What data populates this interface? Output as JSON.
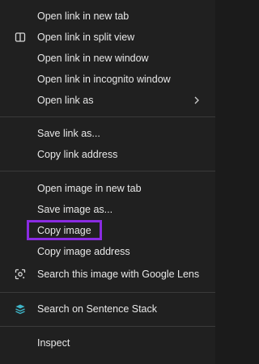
{
  "context_menu": {
    "group_link": {
      "open_new_tab": "Open link in new tab",
      "open_split_view": "Open link in split view",
      "open_new_window": "Open link in new window",
      "open_incognito": "Open link in incognito window",
      "open_link_as": "Open link as"
    },
    "group_save_link": {
      "save_link_as": "Save link as...",
      "copy_link_address": "Copy link address"
    },
    "group_image": {
      "open_image_new_tab": "Open image in new tab",
      "save_image_as": "Save image as...",
      "copy_image": "Copy image",
      "copy_image_address": "Copy image address",
      "search_google_lens": "Search this image with Google Lens"
    },
    "group_extension": {
      "search_sentence_stack": "Search on Sentence Stack"
    },
    "group_dev": {
      "inspect": "Inspect"
    },
    "highlighted_item": "Copy image",
    "highlight_color": "#8a2be2",
    "icons": {
      "split_view": "split-view-icon",
      "submenu": "chevron-right-icon",
      "google_lens": "google-lens-icon",
      "sentence_stack": "sentence-stack-icon"
    }
  }
}
